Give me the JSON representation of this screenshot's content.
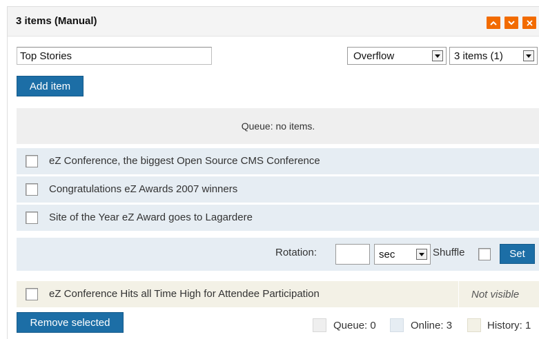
{
  "header": {
    "title": "3 items (Manual)",
    "buttons": [
      {
        "name": "move-up",
        "icon": "chevron-up-icon"
      },
      {
        "name": "move-down",
        "icon": "chevron-down-icon"
      },
      {
        "name": "remove",
        "icon": "close-icon"
      }
    ],
    "accent_color": "#f26b00"
  },
  "block_name": {
    "value": "Top Stories"
  },
  "view_select": {
    "selected": "Overflow"
  },
  "items_select": {
    "selected": "3 items (1)"
  },
  "add_item_label": "Add item",
  "queue_message": "Queue: no items.",
  "items": [
    {
      "label": "eZ Conference, the biggest Open Source CMS Conference",
      "checked": false
    },
    {
      "label": "Congratulations eZ Awards 2007 winners",
      "checked": false
    },
    {
      "label": "Site of the Year eZ Award goes to Lagardere",
      "checked": false
    }
  ],
  "rotation": {
    "label": "Rotation:",
    "value": "",
    "unit": "sec",
    "shuffle_label": "Shuffle",
    "set_label": "Set"
  },
  "hidden_item": {
    "label": "eZ Conference Hits all Time High for Attendee Participation",
    "status": "Not visible"
  },
  "remove_selected_label": "Remove selected",
  "legend": {
    "queue": "Queue: 0",
    "online": "Online: 3",
    "history": "History: 1",
    "queue_color": "#efefef",
    "online_color": "#e6edf3",
    "history_color": "#f3f1e6"
  },
  "button_color": "#1c6ea6"
}
